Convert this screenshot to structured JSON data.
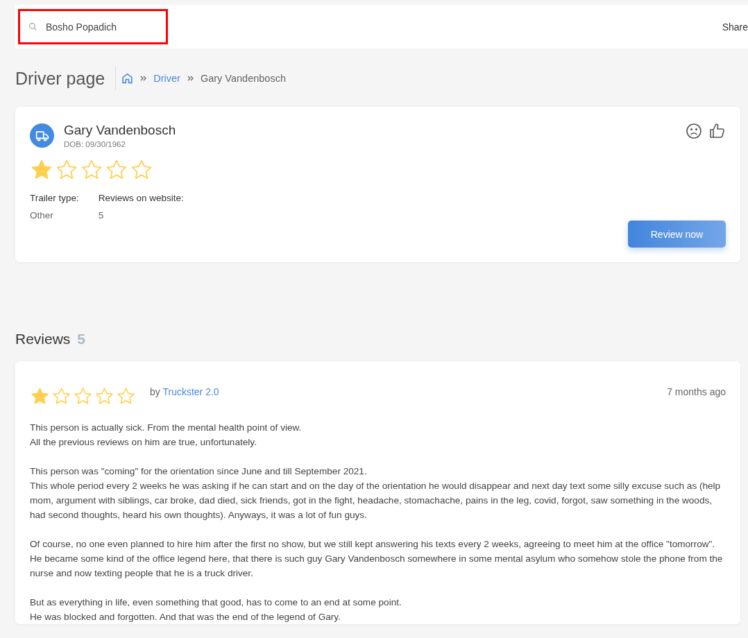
{
  "header": {
    "search": {
      "value": "Bosho Popadich",
      "highlighted": true
    },
    "share_link": "Share"
  },
  "page_title": "Driver page",
  "breadcrumbs": [
    {
      "label": "Driver",
      "link": true
    },
    {
      "label": "Gary Vandenbosch",
      "link": false
    }
  ],
  "driver": {
    "name": "Gary Vandenbosch",
    "dob": "DOB: 09/30/1962",
    "stars": 1,
    "fields": [
      {
        "label": "Trailer type:",
        "value": "Other"
      },
      {
        "label": "Reviews on website:",
        "value": "5"
      }
    ],
    "review_button": "Review now"
  },
  "reviews": {
    "title": "Reviews",
    "count": "5",
    "items": [
      {
        "stars": 1,
        "by": "by",
        "author": "Truckster 2.0",
        "time": "7 months ago",
        "paragraphs": [
          [
            "This person is actually sick. From the mental health point of view.",
            "All the previous reviews on him are true, unfortunately."
          ],
          [
            "This person was \"coming\" for the orientation since June and till September 2021.",
            "This whole period every 2 weeks he was asking if he can start and on the day of the orientation he would disappear and next day text some silly excuse such as (help mom, argument with siblings, car broke, dad died, sick friends, got in the fight, headache, stomachache, pains in the leg, covid, forgot, saw something in the woods, had second thoughts, heard his own thoughts). Anyways, it was a lot of fun guys."
          ],
          [
            "Of course, no one even planned to hire him after the first no show, but we still kept answering his texts every 2 weeks, agreeing to meet him at the office \"tomorrow\". He became some kind of the office legend here, that there is such guy Gary Vandenbosch somewhere in some mental asylum who somehow stole the phone from the nurse and now texting people that he is a truck driver."
          ],
          [
            "But as everything in life, even something that good, has to come to an end at some point.",
            "He was blocked and forgotten. And that was the end of the legend of Gary."
          ]
        ]
      }
    ]
  }
}
